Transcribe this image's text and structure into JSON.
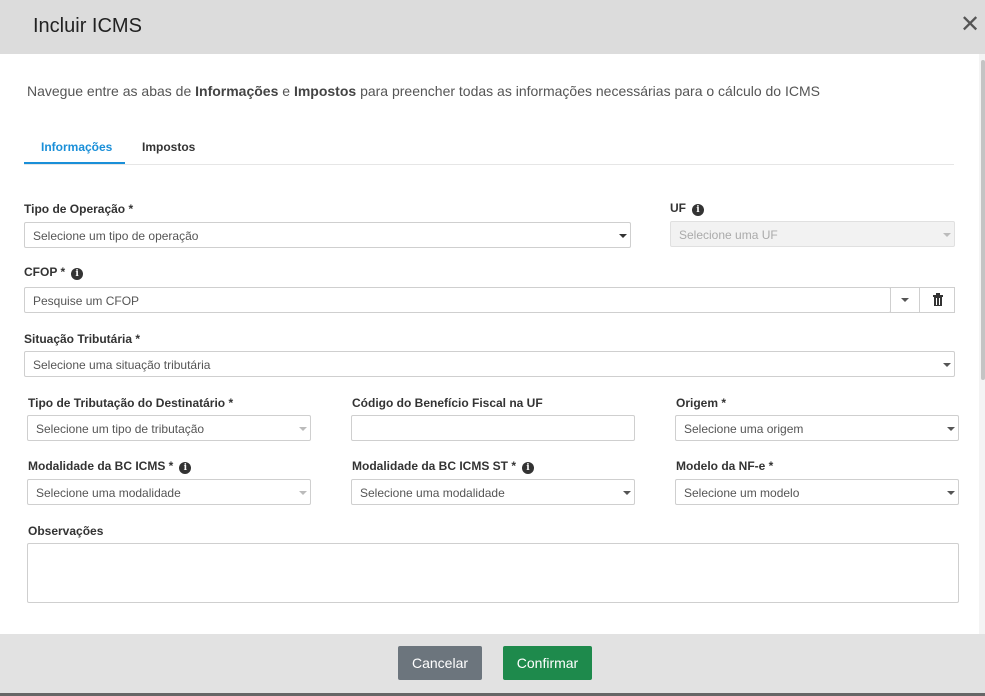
{
  "modal": {
    "title": "Incluir ICMS",
    "close_glyph": "✕"
  },
  "intro": {
    "part1": "Navegue entre as abas de ",
    "bold1": "Informações",
    "part2": " e ",
    "bold2": "Impostos",
    "part3": " para preencher todas as informações necessárias para o cálculo do ICMS"
  },
  "tabs": [
    {
      "label": "Informações",
      "active": true
    },
    {
      "label": "Impostos",
      "active": false
    }
  ],
  "fields": {
    "tipo_operacao": {
      "label": "Tipo de Operação *",
      "placeholder": "Selecione um tipo de operação"
    },
    "uf": {
      "label": "UF",
      "placeholder": "Selecione uma UF",
      "disabled": true
    },
    "cfop": {
      "label": "CFOP *",
      "placeholder": "Pesquise um CFOP"
    },
    "situacao_tributaria": {
      "label": "Situação Tributária *",
      "placeholder": "Selecione uma situação tributária"
    },
    "tipo_tributacao_destinatario": {
      "label": "Tipo de Tributação do Destinatário *",
      "placeholder": "Selecione um tipo de tributação"
    },
    "codigo_beneficio_fiscal": {
      "label": "Código do Benefício Fiscal na UF",
      "value": ""
    },
    "origem": {
      "label": "Origem *",
      "placeholder": "Selecione uma origem"
    },
    "modalidade_bc_icms": {
      "label": "Modalidade da BC ICMS *",
      "placeholder": "Selecione uma modalidade"
    },
    "modalidade_bc_icms_st": {
      "label": "Modalidade da BC ICMS ST *",
      "placeholder": "Selecione uma modalidade"
    },
    "modelo_nfe": {
      "label": "Modelo da NF-e *",
      "placeholder": "Selecione um modelo"
    },
    "observacoes": {
      "label": "Observações",
      "value": ""
    }
  },
  "info_glyph": "i",
  "footer": {
    "cancel_label": "Cancelar",
    "confirm_label": "Confirmar"
  },
  "colors": {
    "accent": "#1a8fd8",
    "confirm": "#1e8a4c",
    "cancel": "#6c757d"
  }
}
